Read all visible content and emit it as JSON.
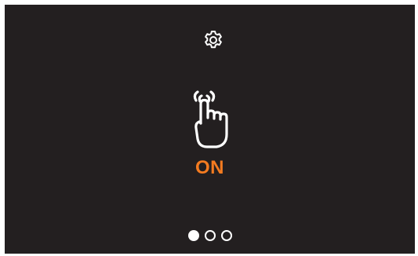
{
  "screen": {
    "background": "#231f20",
    "accent": "#f47b20",
    "settings_icon": "gear-icon",
    "main_icon": "touch-hand-icon",
    "status_label": "ON"
  },
  "pager": {
    "pages": 3,
    "active_index": 0
  }
}
